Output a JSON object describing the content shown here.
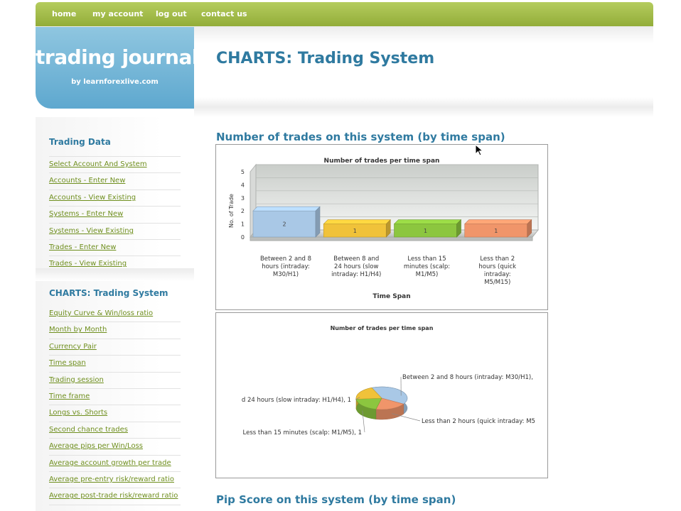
{
  "nav": {
    "items": [
      "home",
      "my account",
      "log out",
      "contact us"
    ]
  },
  "logo": {
    "title": "trading journal",
    "subtitle": "by learnforexlive.com"
  },
  "page": {
    "title": "CHARTS: Trading System"
  },
  "sidebar": {
    "section1": {
      "heading": "Trading Data",
      "links": [
        "Select Account And System",
        "Accounts - Enter New",
        "Accounts - View Existing",
        "Systems - Enter New",
        "Systems - View Existing",
        "Trades - Enter New",
        "Trades - View Existing"
      ]
    },
    "section2": {
      "heading": "CHARTS: Trading System",
      "links": [
        "Equity Curve & Win/loss ratio",
        "Month by Month",
        "Currency Pair",
        "Time span",
        "Trading session",
        "Time frame",
        "Longs vs. Shorts",
        "Second chance trades",
        "Average pips per Win/Loss",
        "Average account growth per trade",
        "Average pre-entry risk/reward ratio",
        "Average post-trade risk/reward ratio"
      ]
    }
  },
  "main": {
    "section1_title": "Number of trades on this system (by time span)",
    "section2_title": "Pip Score on this system (by time span)"
  },
  "colors": {
    "accent": "#2f7aa0",
    "nav": "#9bb43f",
    "link": "#6f8f1e"
  },
  "chart_data": [
    {
      "type": "bar",
      "title": "Number of trades per time span",
      "xlabel": "Time Span",
      "ylabel": "No. of Trade",
      "ylim": [
        0,
        5
      ],
      "yticks": [
        "0",
        "1",
        "2",
        "3",
        "4",
        "5"
      ],
      "categories": [
        [
          "Between 2 and 8",
          "hours (intraday:",
          "M30/H1)"
        ],
        [
          "Between 8 and",
          "24 hours (slow",
          "intraday: H1/H4)"
        ],
        [
          "Less than 15",
          "minutes (scalp:",
          "M1/M5)"
        ],
        [
          "Less than 2",
          "hours (quick",
          "intraday:",
          "M5/M15)"
        ]
      ],
      "values": [
        2,
        1,
        1,
        1
      ],
      "colors": [
        "#a9c8e6",
        "#f0c23a",
        "#8cc63f",
        "#f0956a"
      ]
    },
    {
      "type": "pie",
      "title": "Number of trades per time span",
      "slices": [
        {
          "label": "Between 2 and 8 hours (intraday: M30/H1),",
          "value": 2,
          "color": "#a9c8e6"
        },
        {
          "label": "Less than 2 hours (quick intraday: M5",
          "value": 1,
          "color": "#f0956a"
        },
        {
          "label": "Less than 15 minutes (scalp: M1/M5), 1",
          "value": 1,
          "color": "#8cc63f"
        },
        {
          "label": "d 24 hours (slow intraday: H1/H4), 1",
          "value": 1,
          "color": "#f0c23a"
        }
      ]
    }
  ]
}
